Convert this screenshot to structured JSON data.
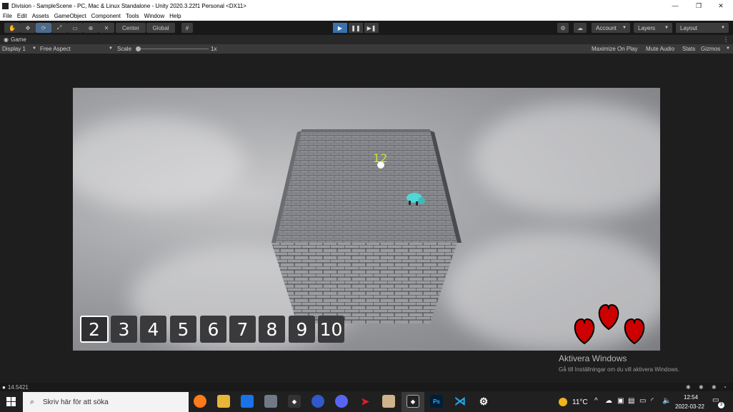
{
  "window": {
    "title": "Division - SampleScene - PC, Mac & Linux Standalone - Unity 2020.3.22f1 Personal <DX11>",
    "minimize": "—",
    "maximize": "❐",
    "close": "✕"
  },
  "menu": [
    "File",
    "Edit",
    "Assets",
    "GameObject",
    "Component",
    "Tools",
    "Window",
    "Help"
  ],
  "toolbar": {
    "center_label": "Center",
    "global_label": "Global",
    "play": "▶",
    "pause": "❚❚",
    "step": "▶❚",
    "account_label": "Account",
    "layers_label": "Layers",
    "layout_label": "Layout"
  },
  "game_tab": {
    "label": "Game",
    "display": "Display 1",
    "aspect": "Free Aspect",
    "scale_label": "Scale",
    "scale_value": "1x",
    "maximize_on_play": "Maximize On Play",
    "mute_audio": "Mute Audio",
    "stats": "Stats",
    "gizmos": "Gizmos"
  },
  "game": {
    "score": "12",
    "number_buttons": [
      "2",
      "3",
      "4",
      "5",
      "6",
      "7",
      "8",
      "9",
      "10"
    ],
    "selected_button": "2",
    "hearts": 3,
    "heart_color": "#cc0000",
    "wall_color": "#7b7c80",
    "player_color": "#4fd6d6"
  },
  "watermark": {
    "title": "Aktivera Windows",
    "subtitle": "Gå till Inställningar om du vill aktivera Windows."
  },
  "status": {
    "value": "14.5421"
  },
  "taskbar": {
    "search_placeholder": "Skriv här för att söka",
    "temperature": "11°C",
    "time": "12:54",
    "date": "2022-03-22",
    "notification_count": "3"
  }
}
